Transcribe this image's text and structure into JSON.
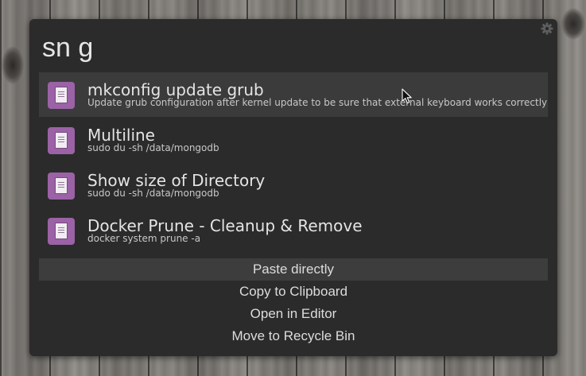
{
  "launcher": {
    "query": "sn g",
    "settings_icon": "gear-icon"
  },
  "results": [
    {
      "title": "mkconfig update grub",
      "subtitle": "Update grub configuration after kernel update to be sure that external keyboard works correctly",
      "icon": "document-icon",
      "selected": true
    },
    {
      "title": "Multiline",
      "subtitle": "sudo du -sh /data/mongodb",
      "icon": "document-icon",
      "selected": false
    },
    {
      "title": "Show size of Directory",
      "subtitle": "sudo du -sh /data/mongodb",
      "icon": "document-icon",
      "selected": false
    },
    {
      "title": "Docker Prune - Cleanup & Remove",
      "subtitle": "docker system prune -a",
      "icon": "document-icon",
      "selected": false
    }
  ],
  "actions": [
    {
      "label": "Paste directly",
      "selected": true
    },
    {
      "label": "Copy to Clipboard",
      "selected": false
    },
    {
      "label": "Open in Editor",
      "selected": false
    },
    {
      "label": "Move to Recycle Bin",
      "selected": false
    }
  ],
  "colors": {
    "panel_background": "#2b2b2b",
    "selected_row": "#3b3b3b",
    "icon_accent": "#9b62a6",
    "text_primary": "#e4e4e4"
  }
}
